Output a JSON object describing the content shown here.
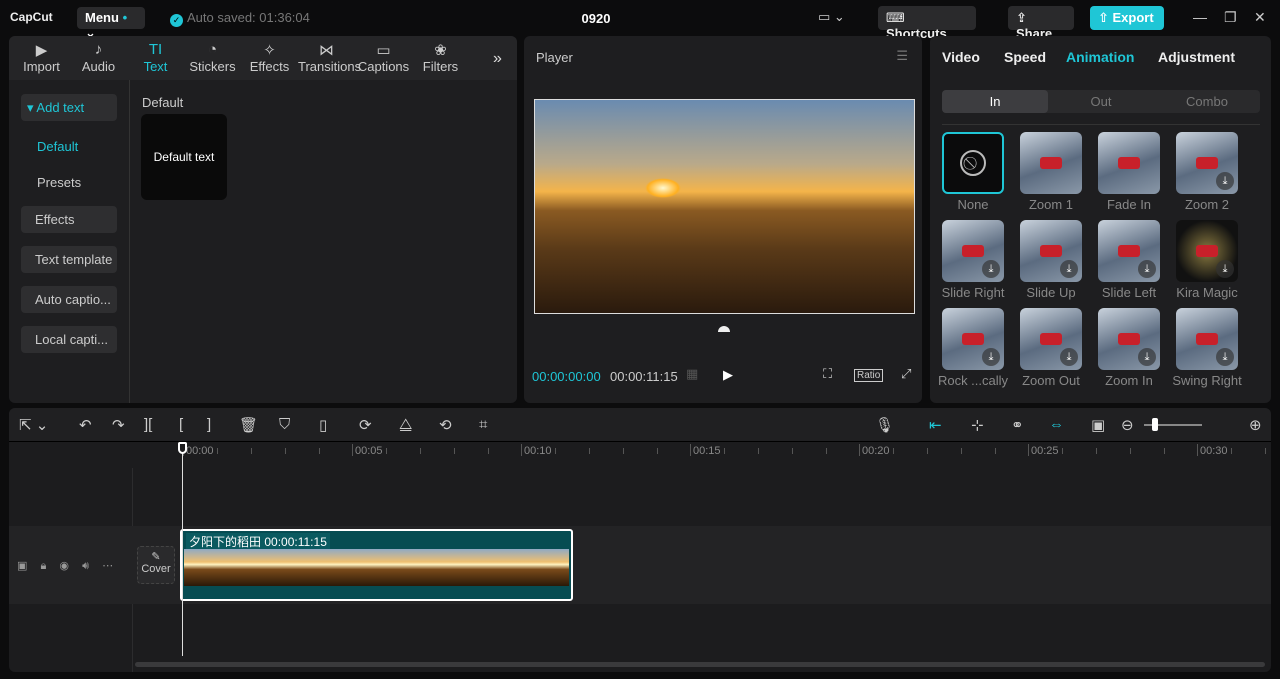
{
  "app": {
    "logo": "CapCut",
    "menu": "Menu",
    "auto_saved": "Auto saved: 01:36:04",
    "project_title": "0920",
    "shortcuts": "Shortcuts",
    "share": "Share",
    "export": "Export"
  },
  "left_panel": {
    "tabs": [
      {
        "label": "Import",
        "icon": "▶"
      },
      {
        "label": "Audio",
        "icon": "♪"
      },
      {
        "label": "Text",
        "icon": "TI"
      },
      {
        "label": "Stickers",
        "icon": "◔"
      },
      {
        "label": "Effects",
        "icon": "✧"
      },
      {
        "label": "Transitions",
        "icon": "⋈"
      },
      {
        "label": "Captions",
        "icon": "▭"
      },
      {
        "label": "Filters",
        "icon": "❀"
      }
    ],
    "active_tab": "Text",
    "nav": {
      "add_text": "Add text",
      "default": "Default",
      "presets": "Presets",
      "effects": "Effects",
      "text_template": "Text template",
      "auto_captions": "Auto captio...",
      "local_captions": "Local capti..."
    },
    "section_title": "Default",
    "default_card": "Default text"
  },
  "player": {
    "title": "Player",
    "current_time": "00:00:00:00",
    "total_time": "00:00:11:15",
    "ratio": "Ratio"
  },
  "right_panel": {
    "tabs": [
      "Video",
      "Speed",
      "Animation",
      "Adjustment"
    ],
    "active_tab": "Animation",
    "segments": [
      "In",
      "Out",
      "Combo"
    ],
    "animations": [
      {
        "name": "None"
      },
      {
        "name": "Zoom 1"
      },
      {
        "name": "Fade In"
      },
      {
        "name": "Zoom 2",
        "download": true
      },
      {
        "name": "Slide Right",
        "download": true
      },
      {
        "name": "Slide Up",
        "download": true
      },
      {
        "name": "Slide Left",
        "download": true
      },
      {
        "name": "Kira Magic",
        "download": true
      },
      {
        "name": "Rock ...cally",
        "download": true
      },
      {
        "name": "Zoom Out",
        "download": true
      },
      {
        "name": "Zoom In",
        "download": true
      },
      {
        "name": "Swing Right",
        "download": true
      }
    ]
  },
  "timeline": {
    "ruler": [
      "00:00",
      "00:05",
      "00:10",
      "00:15",
      "00:20",
      "00:25",
      "00:30"
    ],
    "clip_name": "夕阳下的稻田",
    "clip_duration": "00:00:11:15",
    "cover": "Cover",
    "accent": "#1fc6d6"
  }
}
